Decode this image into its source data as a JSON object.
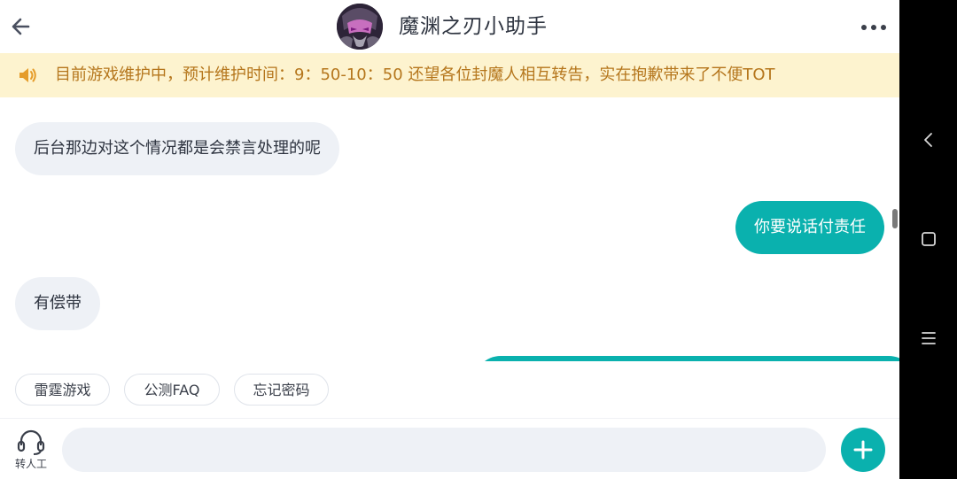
{
  "header": {
    "title": "魔渊之刃小助手",
    "back_icon": "arrow-left-icon",
    "more_icon": "more-horizontal-icon"
  },
  "notice": {
    "icon": "speaker-icon",
    "text": "目前游戏维护中，预计维护时间：9：50-10：50 还望各位封魔人相互转告，实在抱歉带来了不便TOT"
  },
  "messages": [
    {
      "side": "in",
      "text": "后台那边对这个情况都是会禁言处理的呢"
    },
    {
      "side": "out",
      "text": "你要说话付责任"
    },
    {
      "side": "in",
      "text": "有偿带"
    },
    {
      "side": "out",
      "text": ""
    }
  ],
  "quick_replies": [
    "雷霆游戏",
    "公测FAQ",
    "忘记密码"
  ],
  "input": {
    "agent_label": "转人工",
    "placeholder": "",
    "value": ""
  },
  "colors": {
    "accent": "#0ab1ae",
    "notice_bg": "#fdf3cf",
    "notice_text": "#b5761c",
    "incoming_bubble": "#eef1f6"
  }
}
